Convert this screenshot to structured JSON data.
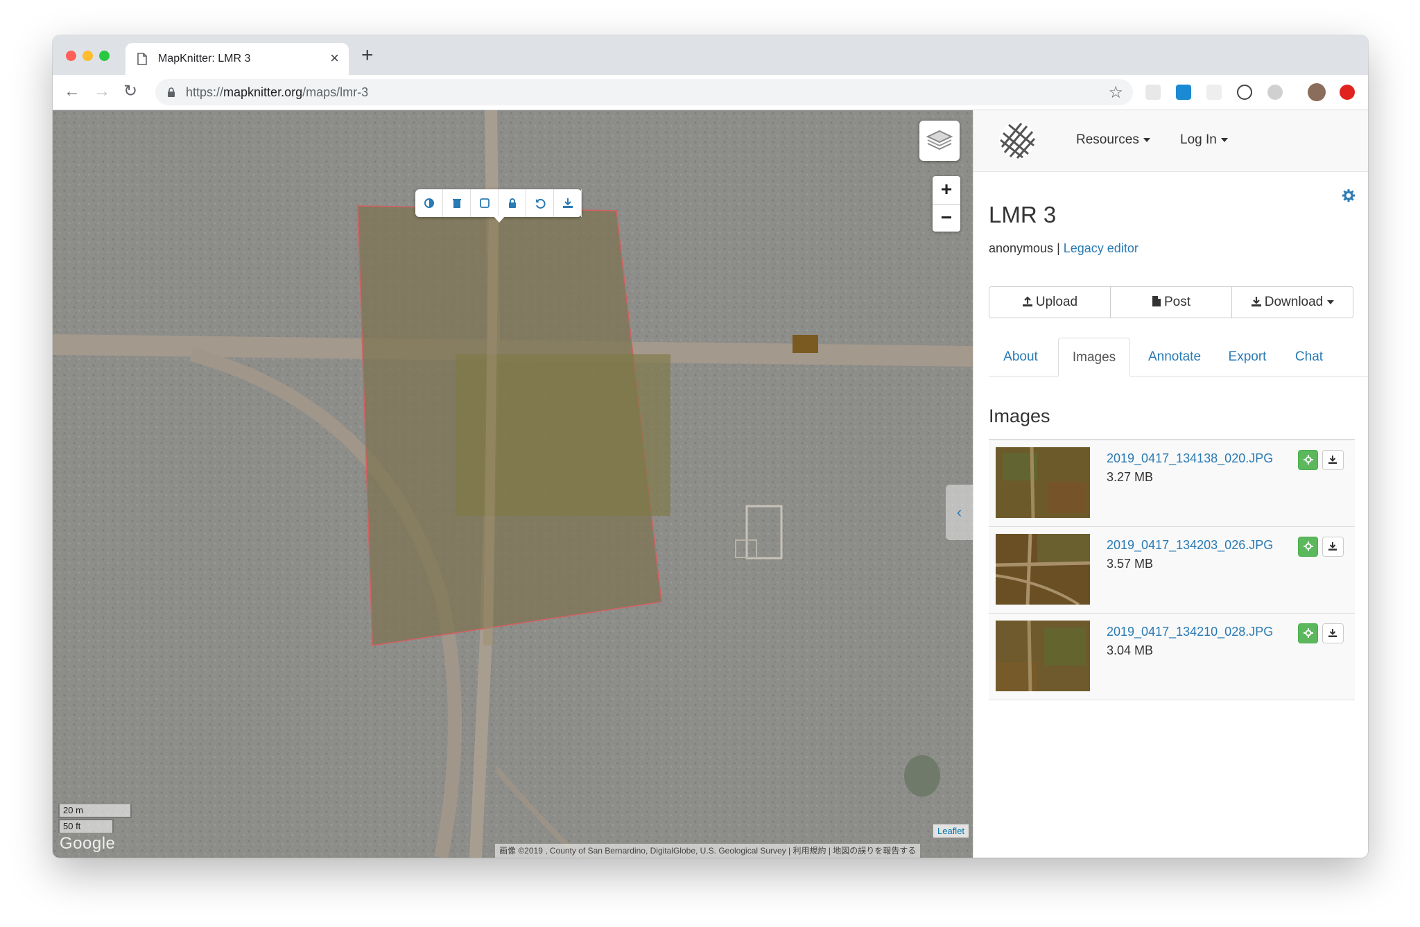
{
  "browser": {
    "tab_title": "MapKnitter: LMR 3",
    "new_tab": "+",
    "tab_close": "×",
    "url_scheme": "https://",
    "url_host": "mapknitter.org",
    "url_path": "/maps/lmr-3",
    "back": "←",
    "forward": "→",
    "reload": "↻",
    "bookmark": "☆"
  },
  "map": {
    "zoom_in": "+",
    "zoom_out": "−",
    "collapse": "‹",
    "scale_metric": "20 m",
    "scale_imperial": "50 ft",
    "google_logo": "Google",
    "leaflet_attribution": "Leaflet",
    "imagery_attribution": "画像 ©2019 , County of San Bernardino, DigitalGlobe, U.S. Geological Survey  |  利用規約  |  地図の誤りを報告する",
    "toolbar_icons": [
      "transparency-icon",
      "delete-icon",
      "outline-icon",
      "lock-icon",
      "reset-icon",
      "export-icon"
    ]
  },
  "sidebar": {
    "nav": {
      "resources": "Resources",
      "login": "Log In"
    },
    "title": "LMR 3",
    "author": "anonymous",
    "separator": " | ",
    "legacy_link": "Legacy editor",
    "buttons": {
      "upload": "Upload",
      "post": "Post",
      "download": "Download"
    },
    "tabs": [
      {
        "label": "About",
        "active": false
      },
      {
        "label": "Images",
        "active": true
      },
      {
        "label": "Annotate",
        "active": false
      },
      {
        "label": "Export",
        "active": false
      },
      {
        "label": "Chat",
        "active": false
      }
    ],
    "images_heading": "Images",
    "images": [
      {
        "filename": "2019_0417_134138_020.JPG",
        "size": "3.27 MB"
      },
      {
        "filename": "2019_0417_134203_026.JPG",
        "size": "3.57 MB"
      },
      {
        "filename": "2019_0417_134210_028.JPG",
        "size": "3.04 MB"
      }
    ]
  },
  "colors": {
    "link": "#2a7ab3",
    "success": "#5cb85c",
    "map_ground": "#8c8c89"
  }
}
